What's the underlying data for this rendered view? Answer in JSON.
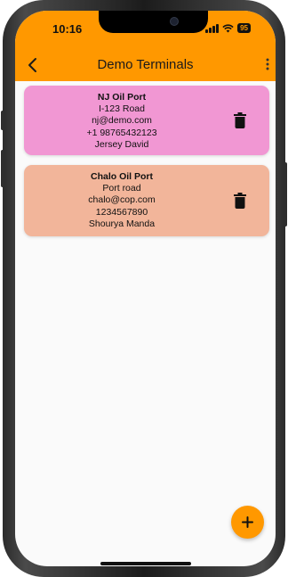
{
  "status_bar": {
    "time": "10:16",
    "battery": "95"
  },
  "app_bar": {
    "title": "Demo Terminals",
    "back_icon": "arrow-back-icon",
    "menu_icon": "more-vert-icon",
    "color": "#ff9800"
  },
  "terminals": [
    {
      "name": "NJ Oil Port",
      "address": "I-123 Road",
      "email": "nj@demo.com",
      "phone": "+1 98765432123",
      "contact": "Jersey David",
      "color": "#f197d3"
    },
    {
      "name": "Chalo Oil Port",
      "address": "Port road",
      "email": "chalo@cop.com",
      "phone": "1234567890",
      "contact": "Shourya Manda",
      "color": "#f2b59a"
    }
  ],
  "fab": {
    "icon": "plus-icon",
    "color": "#ff9800"
  }
}
